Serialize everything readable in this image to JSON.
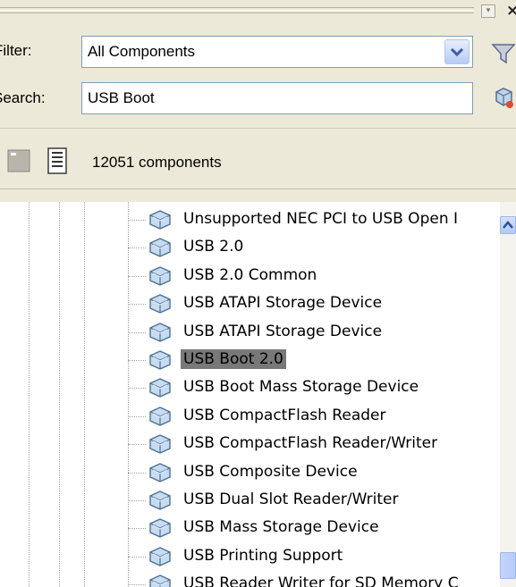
{
  "filter": {
    "label": "Filter:",
    "value": "All Components"
  },
  "search": {
    "label": "Search:",
    "value": "USB Boot"
  },
  "status": {
    "count_text": "12051 components"
  },
  "tree": {
    "items": [
      {
        "label": "Unsupported NEC PCI to USB Open I",
        "selected": false
      },
      {
        "label": "USB 2.0",
        "selected": false
      },
      {
        "label": "USB 2.0 Common",
        "selected": false
      },
      {
        "label": "USB ATAPI Storage Device",
        "selected": false
      },
      {
        "label": "USB ATAPI Storage Device",
        "selected": false
      },
      {
        "label": "USB Boot 2.0",
        "selected": true
      },
      {
        "label": "USB Boot Mass Storage Device",
        "selected": false
      },
      {
        "label": "USB CompactFlash Reader",
        "selected": false
      },
      {
        "label": "USB CompactFlash Reader/Writer",
        "selected": false
      },
      {
        "label": "USB Composite Device",
        "selected": false
      },
      {
        "label": "USB Dual Slot Reader/Writer",
        "selected": false
      },
      {
        "label": "USB Mass Storage Device",
        "selected": false
      },
      {
        "label": "USB Printing Support",
        "selected": false
      },
      {
        "label": "USB Reader Writer for SD Memory C",
        "selected": false
      }
    ]
  },
  "icons": {
    "filter_funnel": "funnel-icon",
    "search_go": "search-globe-icon",
    "item": "component-cube-icon",
    "view_toggle_a": "view-small-icon",
    "view_toggle_b": "view-list-icon"
  },
  "colors": {
    "chrome": "#ECE9D8",
    "field_border": "#7F9DB9",
    "selection": "#787878",
    "xp_blue": "#B6CBF5"
  }
}
